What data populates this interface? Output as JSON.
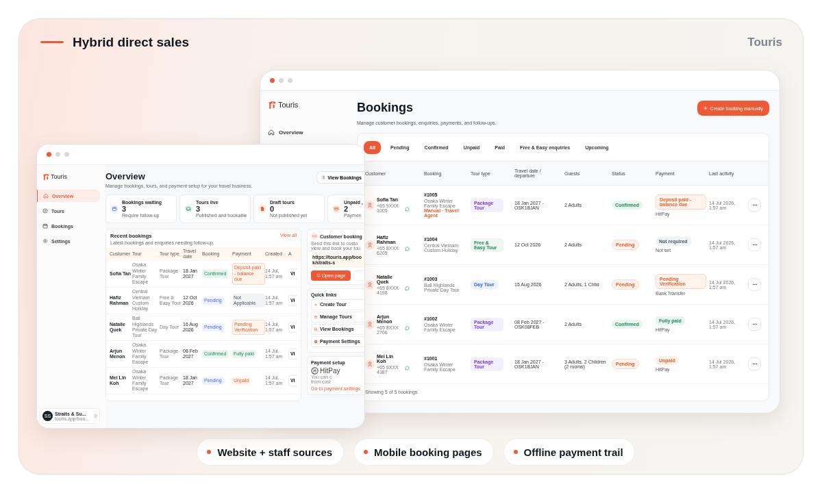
{
  "heading": "Hybrid direct sales",
  "brand": "Touris",
  "back_window": {
    "logo": "Touris",
    "nav": [
      {
        "label": "Overview",
        "selected": false,
        "kind": "home"
      }
    ],
    "title": "Bookings",
    "subtitle": "Manage customer bookings, enquiries, payments, and follow-ups.",
    "create_button": "Create booking manually",
    "filters": [
      {
        "label": "All",
        "selected": true
      },
      {
        "label": "Pending",
        "selected": false
      },
      {
        "label": "Confirmed",
        "selected": false
      },
      {
        "label": "Unpaid",
        "selected": false
      },
      {
        "label": "Paid",
        "selected": false
      },
      {
        "label": "Free & Easy enquiries",
        "selected": false
      },
      {
        "label": "Upcoming",
        "selected": false
      }
    ],
    "columns": [
      "Customer",
      "Booking",
      "Tour type",
      "Travel date / departure",
      "Guests",
      "Status",
      "Payment",
      "Last activity"
    ],
    "rows": [
      {
        "name": "Sofia Tan",
        "phone": "+65 9XXX 1005",
        "booking": "#1005",
        "tour": "Osaka Winter Family Escape",
        "source": "Manual · Travel Agent",
        "tour_type": {
          "label": "Package Tour",
          "kind": "package"
        },
        "travel_date": "18 Jan 2027 - OSK18JAN",
        "guests": "2 Adults",
        "status": {
          "label": "Confirmed",
          "kind": "confirmed"
        },
        "payment": {
          "label": "Deposit paid - balance due",
          "kind": "deposit"
        },
        "method": "HitPay",
        "last_activity": "14 Jul 2026, 1:57 am"
      },
      {
        "name": "Hafiz Rahman",
        "phone": "+65 8XXX 6205",
        "booking": "#1004",
        "tour": "Central Vietnam Custom Holiday",
        "tour_type": {
          "label": "Free & Easy Tour",
          "kind": "free"
        },
        "travel_date": "12 Oct 2026",
        "guests": "2 Adults",
        "status": {
          "label": "Pending",
          "kind": "pending"
        },
        "payment": {
          "label": "Not required",
          "kind": "none"
        },
        "method": "Not set",
        "last_activity": "14 Jul 2026, 1:57 am"
      },
      {
        "name": "Natalie Quek",
        "phone": "+65 8XXX 4198",
        "booking": "#1003",
        "tour": "Bali Highlands Private Day Tour",
        "tour_type": {
          "label": "Day Tour",
          "kind": "day"
        },
        "travel_date": "15 Aug 2026",
        "guests": "2 Adults, 1 Child",
        "status": {
          "label": "Pending",
          "kind": "pending"
        },
        "payment": {
          "label": "Pending Verification",
          "kind": "verify"
        },
        "method": "Bank Transfer",
        "last_activity": "14 Jul 2026, 1:57 am"
      },
      {
        "name": "Arjun Menon",
        "phone": "+65 8XXX 2706",
        "booking": "#1002",
        "tour": "Osaka Winter Family Escape",
        "tour_type": {
          "label": "Package Tour",
          "kind": "package"
        },
        "travel_date": "08 Feb 2027 - OSK08FEB",
        "guests": "2 Adults",
        "status": {
          "label": "Confirmed",
          "kind": "confirmed"
        },
        "payment": {
          "label": "Fully paid",
          "kind": "paid"
        },
        "method": "HitPay",
        "last_activity": "14 Jul 2026, 1:57 am"
      },
      {
        "name": "Mei Lin Koh",
        "phone": "+65 9XXX 4387",
        "booking": "#1001",
        "tour": "Osaka Winter Family Escape",
        "tour_type": {
          "label": "Package Tour",
          "kind": "package"
        },
        "travel_date": "18 Jan 2027 - OSK18JAN",
        "guests": "3 Adults, 2 Children (2 rooms)",
        "status": {
          "label": "Pending",
          "kind": "pending"
        },
        "payment": {
          "label": "Unpaid",
          "kind": "unpaid"
        },
        "method": "HitPay",
        "last_activity": "14 Jul 2026, 1:57 am"
      }
    ],
    "footer": "Showing 5 of 5 bookings"
  },
  "front_window": {
    "logo": "Touris",
    "nav": [
      {
        "label": "Overview",
        "selected": true,
        "kind": "home"
      },
      {
        "label": "Tours",
        "selected": false,
        "kind": "compass"
      },
      {
        "label": "Bookings",
        "selected": false,
        "kind": "calendar"
      },
      {
        "label": "Settings",
        "selected": false,
        "kind": "gear"
      }
    ],
    "account": {
      "initials": "SS",
      "name": "Straits & Su...",
      "url": "touris.app/boo..."
    },
    "title": "Overview",
    "subtitle": "Manage bookings, tours, and payment setup for your travel business.",
    "view_button": "View Bookings",
    "stats": [
      {
        "title": "Bookings waiting",
        "value": "3",
        "note": "Require follow-up",
        "kind": "calendar"
      },
      {
        "title": "Tours live",
        "value": "3",
        "note": "Published and bookable",
        "kind": "tray"
      },
      {
        "title": "Draft tours",
        "value": "0",
        "note": "Not published yet",
        "kind": "doc"
      },
      {
        "title": "Unpaid ,",
        "value": "2",
        "note": "Paymen",
        "kind": "card"
      }
    ],
    "recent": {
      "title": "Recent bookings",
      "link": "View all",
      "subtitle": "Latest bookings and enquiries needing follow-up.",
      "columns": [
        "Customer",
        "Tour",
        "Tour type",
        "Travel date",
        "Booking",
        "Payment",
        "Created",
        "A"
      ],
      "rows": [
        {
          "name": "Sofia Tan",
          "tour": "Osaka Winter Family Escape",
          "type": "Package Tour",
          "date": "18 Jan 2027",
          "booking": {
            "label": "Confirmed",
            "kind": "confirmed"
          },
          "payment": {
            "label": "Deposit paid - balance due",
            "kind": "deposit"
          },
          "created": "14 Jul, 1:57 am",
          "action": "Vi"
        },
        {
          "name": "Hafiz Rahman",
          "tour": "Central Vietnam Custom Holiday",
          "type": "Free & Easy Tour",
          "date": "12 Oct 2026",
          "booking": {
            "label": "Pending",
            "kind": "pending"
          },
          "payment": {
            "label": "Not Applicable",
            "kind": "none"
          },
          "created": "14 Jul, 1:57 am",
          "action": "Vi"
        },
        {
          "name": "Natalie Quek",
          "tour": "Bali Highlands Private Day Tour",
          "type": "Day Tour",
          "date": "16 Aug 2026",
          "booking": {
            "label": "Pending",
            "kind": "pending"
          },
          "payment": {
            "label": "Pending Verification",
            "kind": "verify"
          },
          "created": "14 Jul, 1:57 am",
          "action": "Vi"
        },
        {
          "name": "Arjun Menon",
          "tour": "Osaka Winter Family Escape",
          "type": "Package Tour",
          "date": "08 Feb 2027",
          "booking": {
            "label": "Confirmed",
            "kind": "confirmed"
          },
          "payment": {
            "label": "Fully paid",
            "kind": "paid"
          },
          "created": "14 Jul, 1:57 am",
          "action": "Vi"
        },
        {
          "name": "Mei Lin Koh",
          "tour": "Osaka Winter Family Escape",
          "type": "Package Tour",
          "date": "18 Jan 2027",
          "booking": {
            "label": "Pending",
            "kind": "pending"
          },
          "payment": {
            "label": "Unpaid",
            "kind": "unpaid"
          },
          "created": "14 Jul, 1:57 am",
          "action": "Vi"
        }
      ]
    },
    "customer_booking": {
      "title": "Customer booking",
      "description_lines": [
        "Send this link to custo",
        "view and book your tou"
      ],
      "url": "https://touris.app/book/straits-s",
      "button": "Open page"
    },
    "quick_links": {
      "title": "Quick links",
      "items": [
        {
          "label": "Create Tour",
          "kind": "plus"
        },
        {
          "label": "Manage Tours",
          "kind": "calendar"
        },
        {
          "label": "View Bookings",
          "kind": "doc"
        },
        {
          "label": "Payment Settings",
          "kind": "card"
        }
      ]
    },
    "payment_setup": {
      "title": "Payment setup",
      "provider": "HitPay",
      "description_lines": [
        "You can c",
        "from cust"
      ],
      "link": "Go to payment settings"
    }
  },
  "highlights": [
    "Website + staff sources",
    "Mobile booking pages",
    "Offline payment trail"
  ]
}
